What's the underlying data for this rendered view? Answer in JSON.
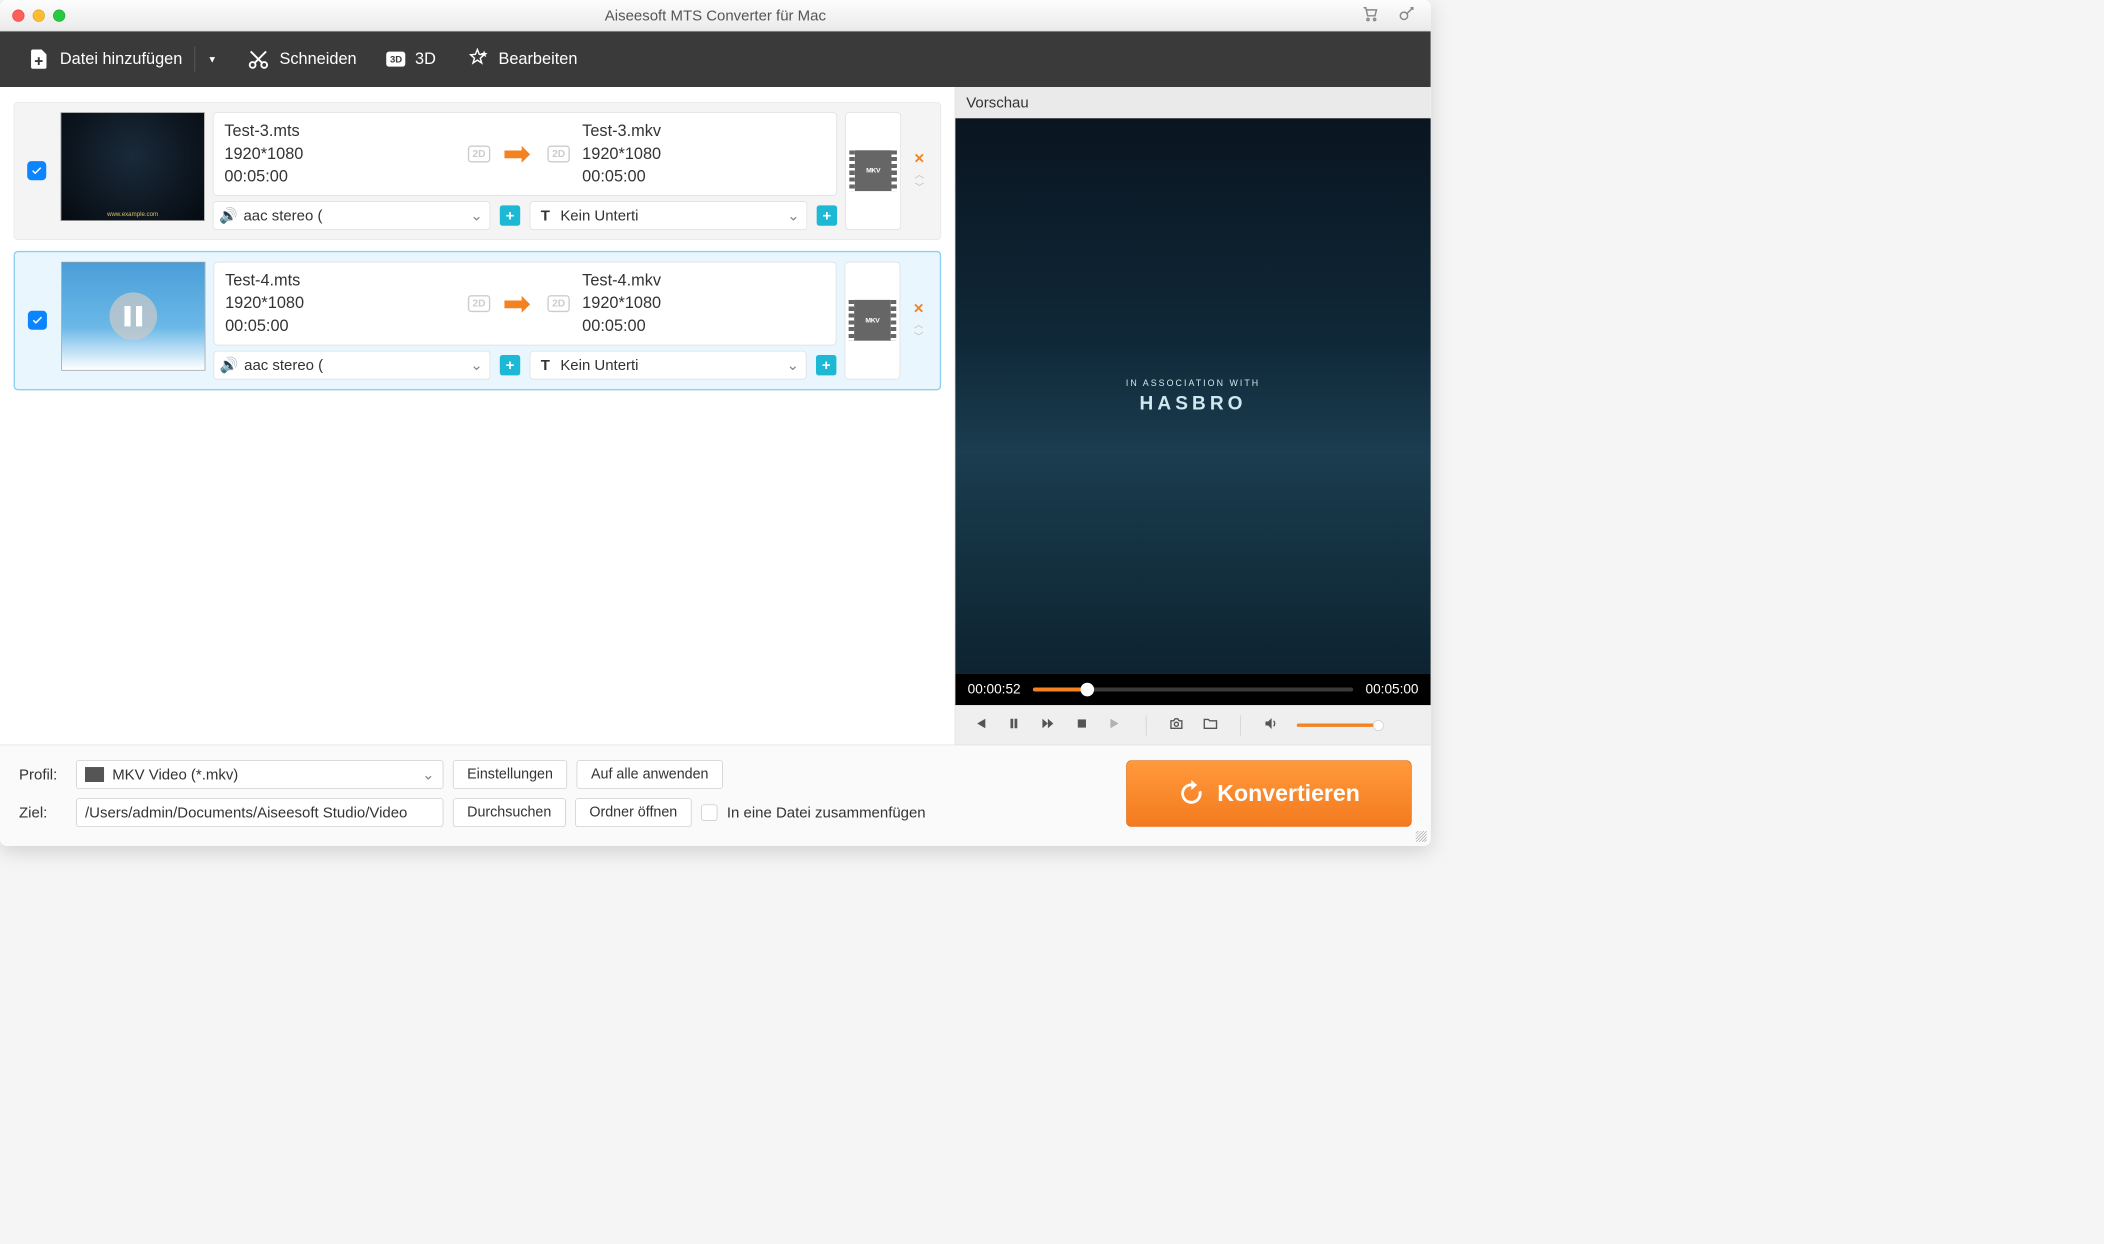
{
  "window": {
    "title": "Aiseesoft MTS Converter für Mac"
  },
  "toolbar": {
    "add_file": "Datei hinzufügen",
    "cut": "Schneiden",
    "three_d": "3D",
    "edit": "Bearbeiten"
  },
  "files": [
    {
      "src_name": "Test-3.mts",
      "src_res": "1920*1080",
      "src_dur": "00:05:00",
      "dst_name": "Test-3.mkv",
      "dst_res": "1920*1080",
      "dst_dur": "00:05:00",
      "audio": "aac stereo (",
      "subtitle": "Kein Unterti",
      "format": "MKV",
      "selected": false,
      "thumb_style": "dark"
    },
    {
      "src_name": "Test-4.mts",
      "src_res": "1920*1080",
      "src_dur": "00:05:00",
      "dst_name": "Test-4.mkv",
      "dst_res": "1920*1080",
      "dst_dur": "00:05:00",
      "audio": "aac stereo (",
      "subtitle": "Kein Unterti",
      "format": "MKV",
      "selected": true,
      "thumb_style": "sky"
    }
  ],
  "preview": {
    "title": "Vorschau",
    "overlay_small": "IN ASSOCIATION WITH",
    "overlay_big": "HASBRO",
    "current_time": "00:00:52",
    "total_time": "00:05:00",
    "progress_pct": 17
  },
  "bottom": {
    "profile_label": "Profil:",
    "profile_value": "MKV Video (*.mkv)",
    "settings": "Einstellungen",
    "apply_all": "Auf alle anwenden",
    "dest_label": "Ziel:",
    "dest_value": "/Users/admin/Documents/Aiseesoft Studio/Video",
    "browse": "Durchsuchen",
    "open_folder": "Ordner öffnen",
    "merge": "In eine Datei zusammenfügen",
    "convert": "Konvertieren"
  }
}
